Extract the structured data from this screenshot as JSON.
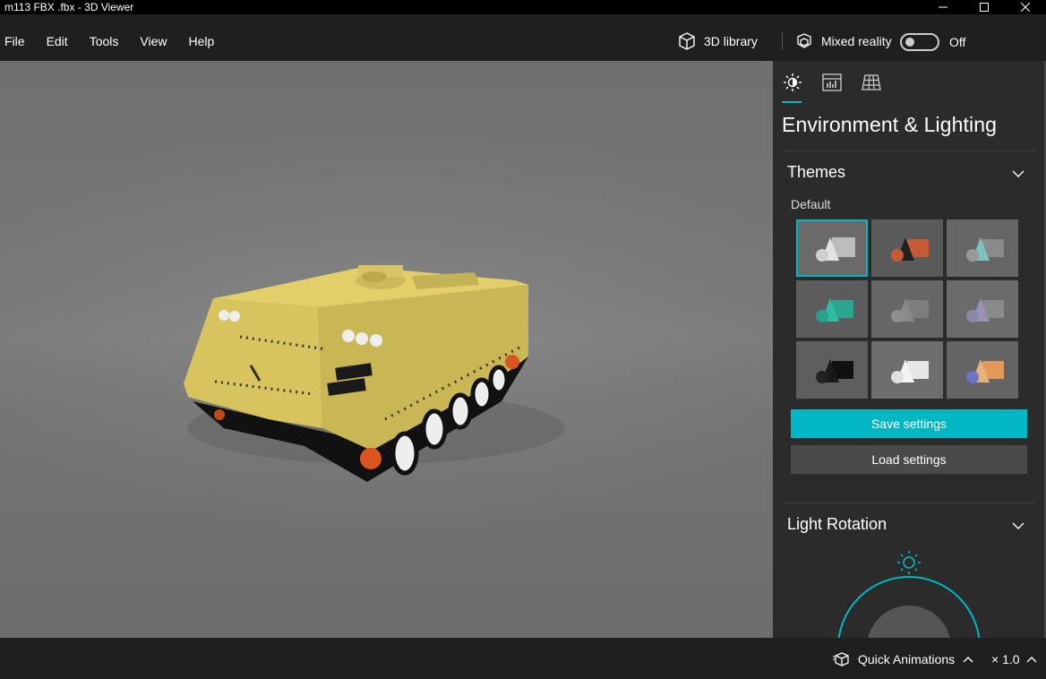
{
  "window": {
    "title": "m113 FBX .fbx - 3D Viewer"
  },
  "menu": {
    "items": [
      "File",
      "Edit",
      "Tools",
      "View",
      "Help"
    ]
  },
  "toolbar": {
    "library_label": "3D library",
    "mixed_reality_label": "Mixed reality",
    "mixed_reality_state": "Off"
  },
  "panel": {
    "title": "Environment & Lighting",
    "themes_label": "Themes",
    "themes_sub_label": "Default",
    "save_label": "Save settings",
    "load_label": "Load settings",
    "light_rotation_label": "Light Rotation",
    "accent_color": "#00b7c3"
  },
  "bottom": {
    "quick_animations_label": "Quick Animations",
    "speed_label": "× 1.0"
  }
}
